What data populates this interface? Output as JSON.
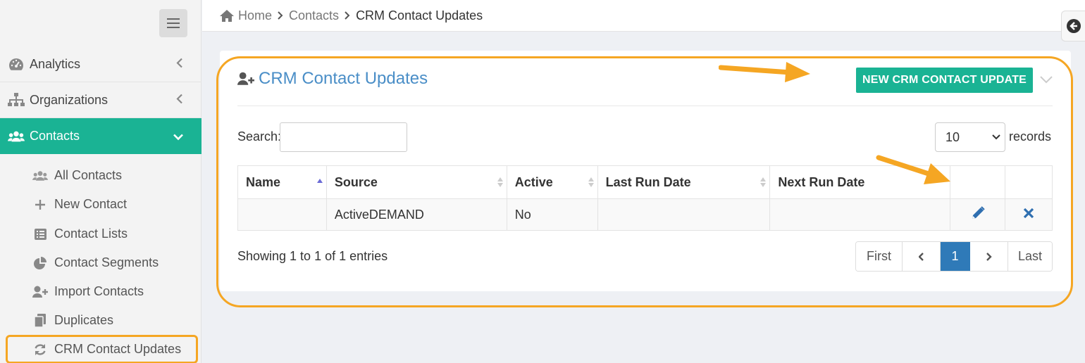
{
  "sidebar": {
    "items": [
      {
        "label": "Analytics",
        "icon": "dashboard-icon"
      },
      {
        "label": "Organizations",
        "icon": "sitemap-icon"
      },
      {
        "label": "Contacts",
        "icon": "users-icon"
      }
    ],
    "subitems": [
      {
        "label": "All Contacts",
        "icon": "users-icon"
      },
      {
        "label": "New Contact",
        "icon": "plus-icon"
      },
      {
        "label": "Contact Lists",
        "icon": "list-icon"
      },
      {
        "label": "Contact Segments",
        "icon": "pie-chart-icon"
      },
      {
        "label": "Import Contacts",
        "icon": "user-plus-icon"
      },
      {
        "label": "Duplicates",
        "icon": "copy-icon"
      },
      {
        "label": "CRM Contact Updates",
        "icon": "refresh-icon"
      }
    ]
  },
  "breadcrumb": {
    "home": "Home",
    "contacts": "Contacts",
    "current": "CRM Contact Updates"
  },
  "panel": {
    "title": "CRM Contact Updates",
    "new_button": "NEW CRM CONTACT UPDATE"
  },
  "table_controls": {
    "search_label": "Search:",
    "search_value": "",
    "page_size": "10",
    "records_label": "records"
  },
  "table": {
    "headers": [
      "Name",
      "Source",
      "Active",
      "Last Run Date",
      "Next Run Date"
    ],
    "rows": [
      {
        "name": "",
        "source": "ActiveDEMAND",
        "active": "No",
        "last_run": "",
        "next_run": ""
      }
    ]
  },
  "footer": {
    "showing": "Showing 1 to 1 of 1 entries",
    "pagination": {
      "first": "First",
      "current": "1",
      "last": "Last"
    }
  },
  "colors": {
    "accent": "#1ab394",
    "link": "#4a8ec7",
    "highlight": "#f5a623",
    "page_active": "#2f7ab8"
  }
}
